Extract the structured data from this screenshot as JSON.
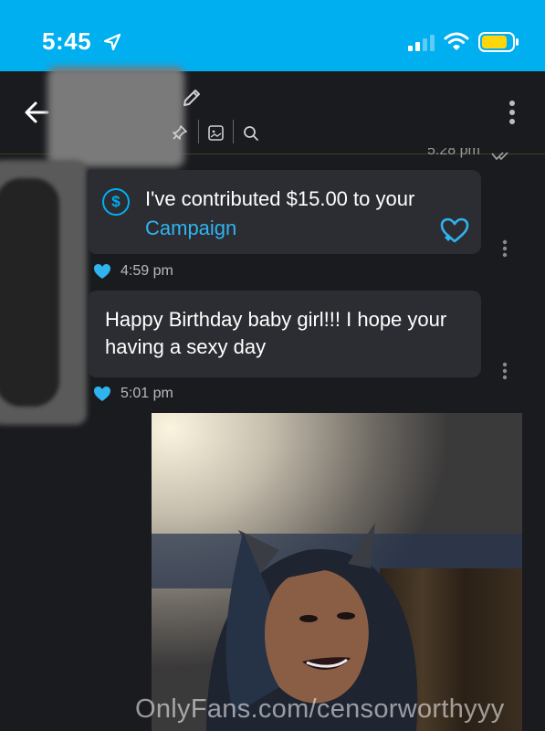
{
  "status_bar": {
    "time": "5:45",
    "icons": [
      "location-arrow-icon",
      "cellular-signal-icon",
      "wifi-icon",
      "battery-icon"
    ],
    "color": "#00aff0"
  },
  "header": {
    "icons": [
      "back-arrow-icon",
      "pencil-icon",
      "pin-icon",
      "media-icon",
      "search-icon",
      "more-vertical-icon"
    ]
  },
  "messages": [
    {
      "type": "tip",
      "text_before": "I've contributed $15.00 to your ",
      "link": "Campaign",
      "time": "4:59 pm",
      "liked": true
    },
    {
      "type": "text",
      "text": "Happy Birthday baby girl!!! I hope your having a sexy day",
      "time": "5:01 pm",
      "liked": true
    }
  ],
  "previous_message_time": "5:28 pm",
  "watermark": "OnlyFans.com/censorworthyyy",
  "accent_color": "#00aff0"
}
